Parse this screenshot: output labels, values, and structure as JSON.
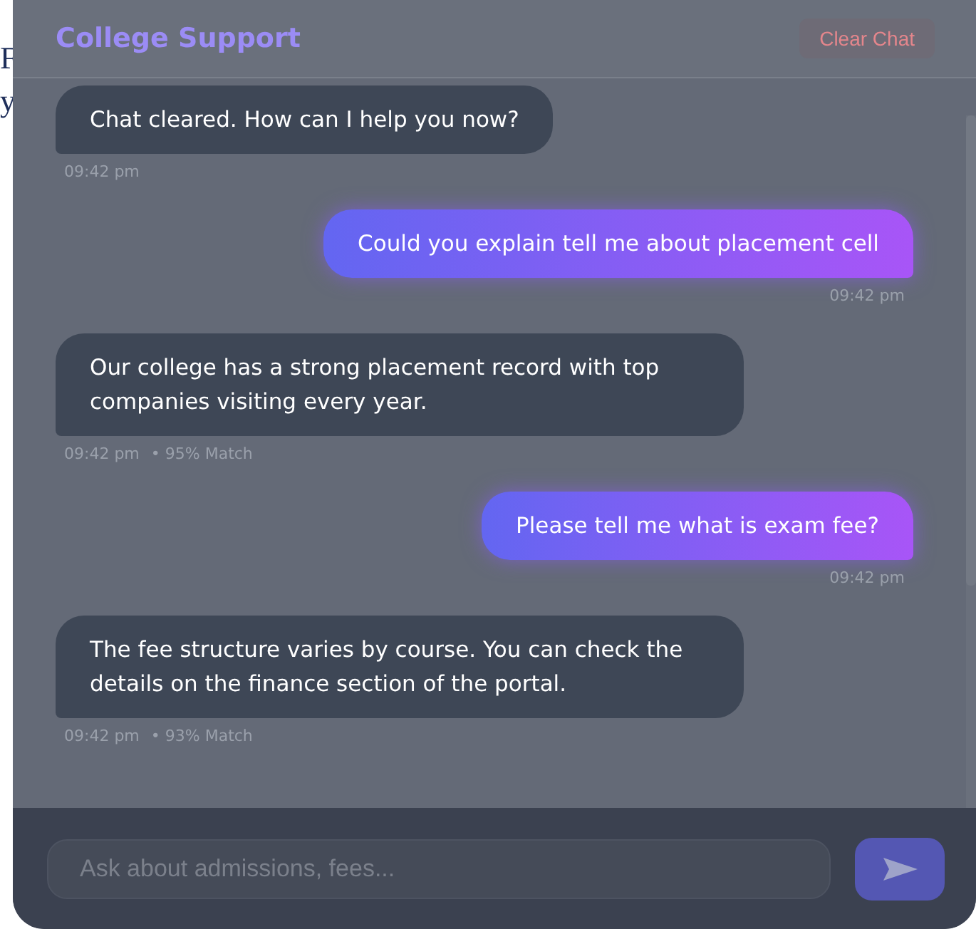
{
  "background_text": [
    "F",
    "y"
  ],
  "header": {
    "title": "College Support",
    "clear_button": "Clear Chat"
  },
  "messages": [
    {
      "kind": "bot",
      "text": "Chat cleared. How can I help you now?",
      "time": "09:42 pm"
    },
    {
      "kind": "user",
      "text": "Could you explain tell me about placement cell",
      "time": "09:42 pm"
    },
    {
      "kind": "bot",
      "text": "Our college has a strong placement record with top companies visiting every year.",
      "time": "09:42 pm",
      "match": "• 95% Match"
    },
    {
      "kind": "user",
      "text": "Please tell me what is exam fee?",
      "time": "09:42 pm"
    },
    {
      "kind": "bot",
      "text": "The fee structure varies by course. You can check the details on the finance section of the portal.",
      "time": "09:42 pm",
      "match": "• 93% Match"
    }
  ],
  "input": {
    "placeholder": "Ask about admissions, fees..."
  }
}
